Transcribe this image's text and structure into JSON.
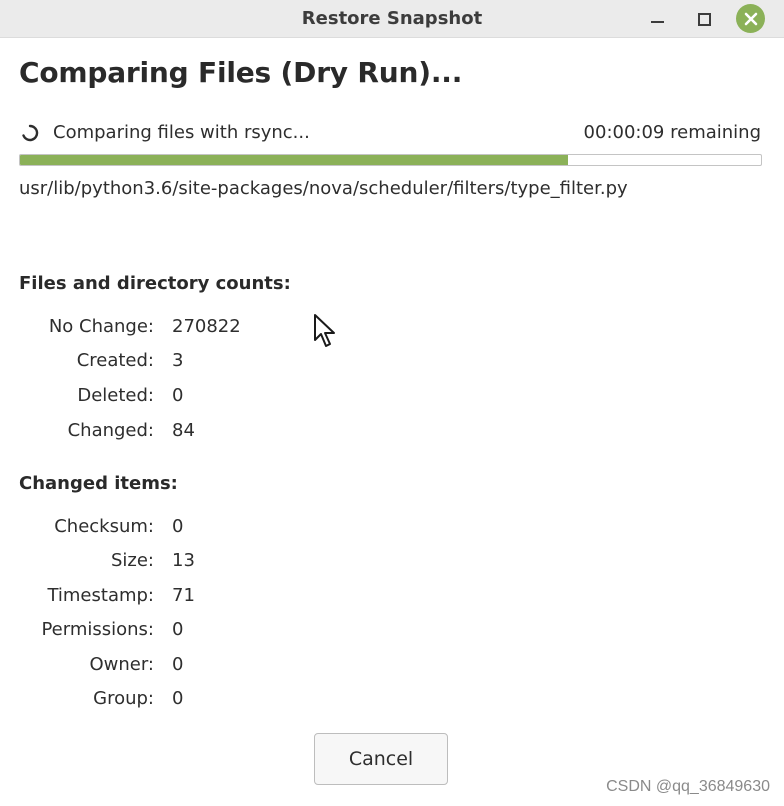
{
  "window": {
    "title": "Restore Snapshot",
    "accent_color": "#8bb158"
  },
  "titlebar_buttons": {
    "minimize_icon": "minimize-icon",
    "maximize_icon": "maximize-icon",
    "close_icon": "close-icon"
  },
  "heading": "Comparing Files (Dry Run)...",
  "status": {
    "text": "Comparing files with rsync...",
    "remaining": "00:00:09 remaining",
    "progress_fraction": 0.74,
    "current_path": "usr/lib/python3.6/site-packages/nova/scheduler/filters/type_filter.py"
  },
  "counts": {
    "title": "Files and directory counts:",
    "rows": [
      {
        "label": "No Change:",
        "value": "270822"
      },
      {
        "label": "Created:",
        "value": "3"
      },
      {
        "label": "Deleted:",
        "value": "0"
      },
      {
        "label": "Changed:",
        "value": "84"
      }
    ]
  },
  "changed_items": {
    "title": "Changed items:",
    "rows": [
      {
        "label": "Checksum:",
        "value": "0"
      },
      {
        "label": "Size:",
        "value": "13"
      },
      {
        "label": "Timestamp:",
        "value": "71"
      },
      {
        "label": "Permissions:",
        "value": "0"
      },
      {
        "label": "Owner:",
        "value": "0"
      },
      {
        "label": "Group:",
        "value": "0"
      }
    ]
  },
  "buttons": {
    "cancel_label": "Cancel"
  },
  "watermark": "CSDN @qq_36849630"
}
